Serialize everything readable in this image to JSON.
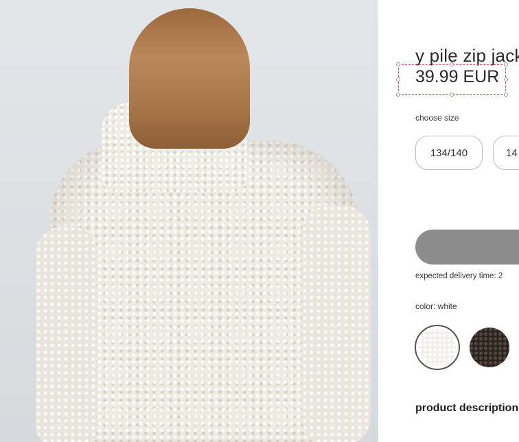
{
  "photo": {
    "alt_icon": "product-photo"
  },
  "product": {
    "title": "y pile zip jack",
    "price": "39.99 EUR"
  },
  "size": {
    "label": "choose size",
    "options": [
      "134/140",
      "14"
    ]
  },
  "cart": {
    "add_label": ""
  },
  "delivery": {
    "text": "expected delivery time: 2"
  },
  "color": {
    "label": "color: white",
    "swatches": [
      {
        "name": "white",
        "hex": "#f1efea",
        "selected": true
      },
      {
        "name": "dark-brown",
        "hex": "#2b2320",
        "selected": false
      }
    ]
  },
  "description": {
    "heading": "product description",
    "first_line": ""
  },
  "colors": {
    "selection_outline": "#d23a3a",
    "button_grey": "#8c8c8c"
  }
}
